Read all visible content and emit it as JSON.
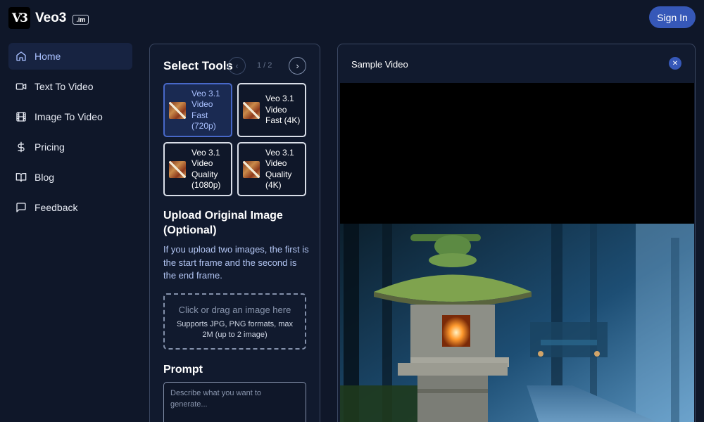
{
  "header": {
    "logo_mark": "V3",
    "logo_text": "Veo3",
    "logo_badge": ".im",
    "signin_label": "Sign In"
  },
  "sidebar": {
    "items": [
      {
        "label": "Home",
        "icon": "home-icon",
        "active": true
      },
      {
        "label": "Text To Video",
        "icon": "video-camera-icon",
        "active": false
      },
      {
        "label": "Image To Video",
        "icon": "film-icon",
        "active": false
      },
      {
        "label": "Pricing",
        "icon": "dollar-icon",
        "active": false
      },
      {
        "label": "Blog",
        "icon": "book-icon",
        "active": false
      },
      {
        "label": "Feedback",
        "icon": "message-icon",
        "active": false
      }
    ]
  },
  "tools": {
    "title": "Select Tools",
    "pager": "1 / 2",
    "items": [
      {
        "label": "Veo 3.1 Video Fast (720p)",
        "selected": true
      },
      {
        "label": "Veo 3.1 Video Fast (4K)",
        "selected": false
      },
      {
        "label": "Veo 3.1 Video Quality (1080p)",
        "selected": false
      },
      {
        "label": "Veo 3.1 Video Quality (4K)",
        "selected": false
      }
    ]
  },
  "upload": {
    "title": "Upload Original Image (Optional)",
    "hint": "If you upload two images, the first is the start frame and the second is the end frame.",
    "drop_main": "Click or drag an image here",
    "drop_sub": "Supports JPG, PNG formats, max 2M (up to 2 image)"
  },
  "prompt": {
    "label": "Prompt",
    "placeholder": "Describe what you want to generate...",
    "value": ""
  },
  "video": {
    "title": "Sample Video",
    "close_icon": "close-icon"
  },
  "colors": {
    "background": "#0f1729",
    "accent": "#3658b8",
    "active_text": "#a9c0ff",
    "hint_text": "#b2c5f3"
  }
}
